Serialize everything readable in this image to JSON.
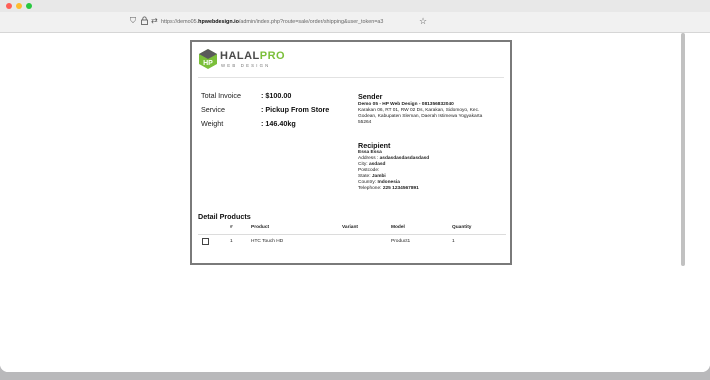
{
  "browser": {
    "url_prefix": "https://demo05.",
    "url_domain": "hpwebdesign.io",
    "url_rest": "/admin/index.php?route=sale/order/shipping&user_token=a3",
    "window_dot_colors": [
      "#ff5f57",
      "#febc2e",
      "#28c840"
    ]
  },
  "brand": {
    "name_main": "HALAL",
    "name_accent": "PRO",
    "tagline": "WEB DESIGN",
    "accent_color": "#7bbf3a"
  },
  "summary": [
    {
      "label": "Total Invoice",
      "value": ": $100.00"
    },
    {
      "label": "Service",
      "value": ": Pickup From Store"
    },
    {
      "label": "Weight",
      "value": ": 146.40kg"
    }
  ],
  "sender": {
    "heading": "Sender",
    "name": "Demo 05 - HP Web Design - 081356832040",
    "address_line1": "Karakan 06, RT 01, RW 02 Ds, Karakan, Sidomoyo, Kec.",
    "address_line2": "Godean, Kabupaten Sleman, Daerah Istimewa Yogyakarta",
    "address_line3": "55264"
  },
  "recipient": {
    "heading": "Recipient",
    "name": "Essa Essa",
    "address_label": "Address :",
    "address_value": "asdasdasdasdasdasd",
    "city_label": "City:",
    "city_value": "asdasd",
    "postcode_label": "Postcode:",
    "state_label": "State:",
    "state_value": "Jambi",
    "country_label": "Country:",
    "country_value": "Indonesia",
    "telephone_label": "Telephone:",
    "telephone_value": "225 1234567891"
  },
  "products": {
    "heading": "Detail Products",
    "columns": [
      "#",
      "Product",
      "Variant",
      "Model",
      "Quantity"
    ],
    "rows": [
      {
        "no": "1",
        "product": "HTC Touch HD",
        "variant": "",
        "model": "Product1",
        "quantity": "1"
      }
    ]
  }
}
